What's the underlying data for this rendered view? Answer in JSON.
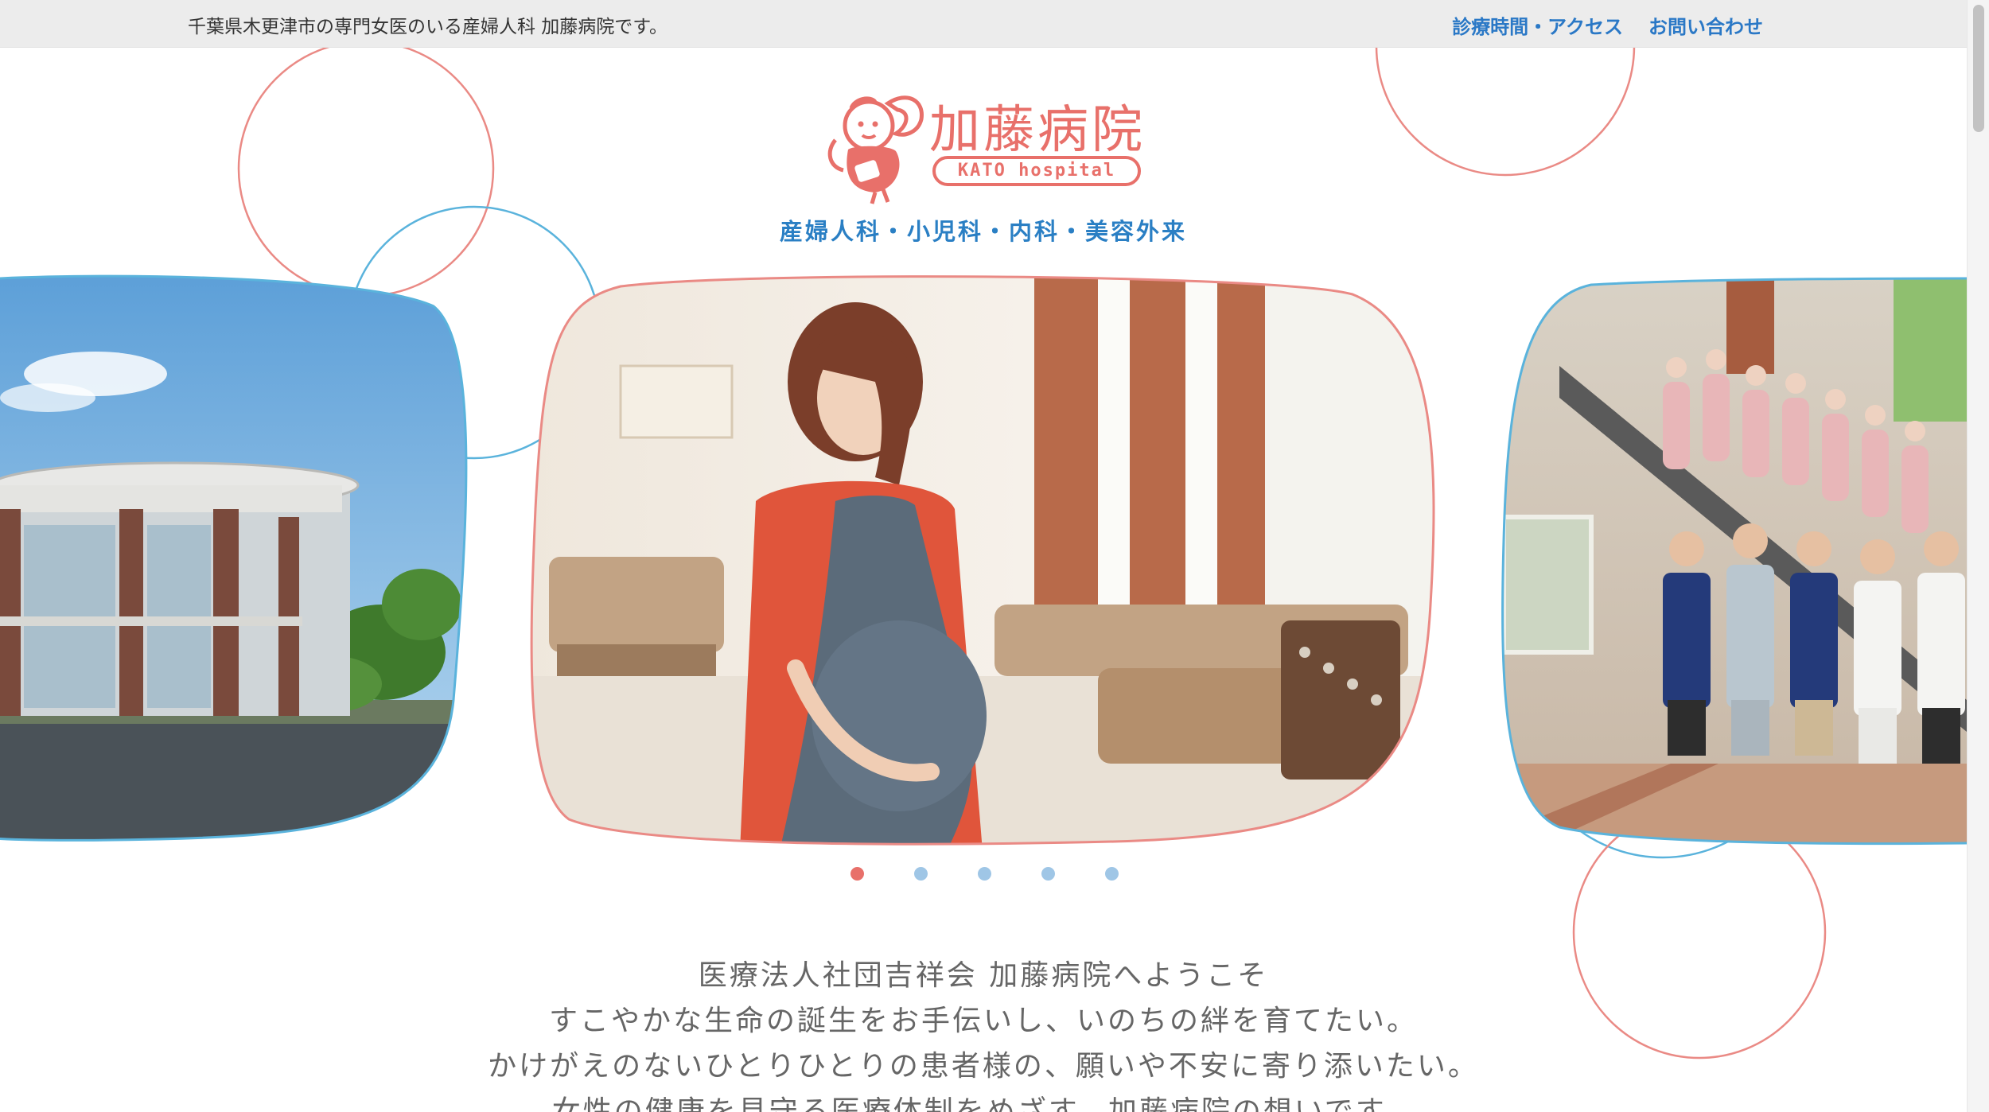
{
  "topbar": {
    "tagline": "千葉県木更津市の専門女医のいる産婦人科 加藤病院です。",
    "links": [
      {
        "label": "診療時間・アクセス"
      },
      {
        "label": "お問い合わせ"
      }
    ]
  },
  "logo": {
    "title": "加藤病院",
    "badge": "KATO hospital"
  },
  "subtitle": "産婦人科・小児科・内科・美容外来",
  "carousel": {
    "slides": 5,
    "active_index": 0,
    "images": [
      "hospital-building",
      "pregnant-woman",
      "hospital-staff"
    ]
  },
  "welcome": {
    "lines": [
      "医療法人社団吉祥会 加藤病院へようこそ",
      "すこやかな生命の誕生をお手伝いし、いのちの絆を育てたい。",
      "かけがえのないひとりひとりの患者様の、願いや不安に寄り添いたい。",
      "女性の健康を見守る医療体制をめざす、加藤病院の想いです。"
    ]
  },
  "colors": {
    "accent_red": "#e8706a",
    "accent_blue": "#2a7fc4",
    "circle_blue": "#5ab3dc",
    "topbar_bg": "#ececec"
  }
}
